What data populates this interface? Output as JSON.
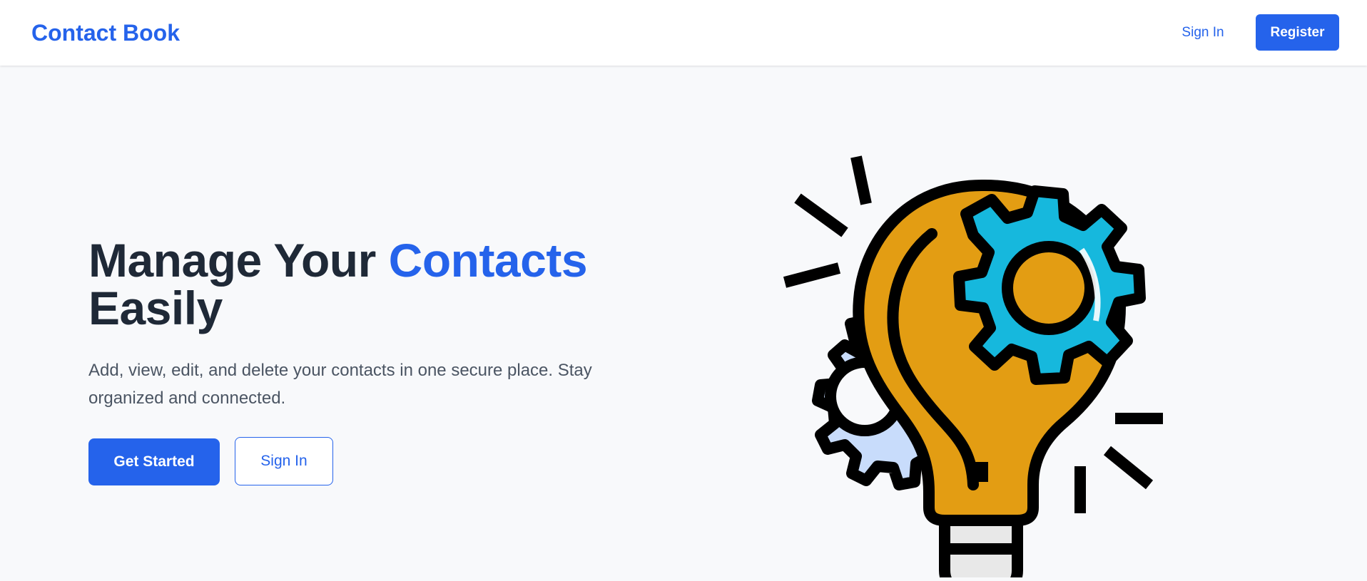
{
  "navbar": {
    "brand": "Contact Book",
    "sign_in": "Sign In",
    "register": "Register"
  },
  "hero": {
    "title_part1": "Manage Your ",
    "title_accent": "Contacts",
    "title_part2": "Easily",
    "subtitle": "Add, view, edit, and delete your contacts in one secure place. Stay organized and connected.",
    "primary_button": "Get Started",
    "secondary_button": "Sign In"
  },
  "illustration": {
    "icon": "lightbulb-gears-icon"
  },
  "colors": {
    "accent": "#2563eb",
    "heading": "#1f2937",
    "body_text": "#4b5563",
    "background": "#f8f9fb",
    "bulb": "#e39d13",
    "gear_blue": "#16b8dd",
    "gear_light": "#c8dcfb"
  }
}
